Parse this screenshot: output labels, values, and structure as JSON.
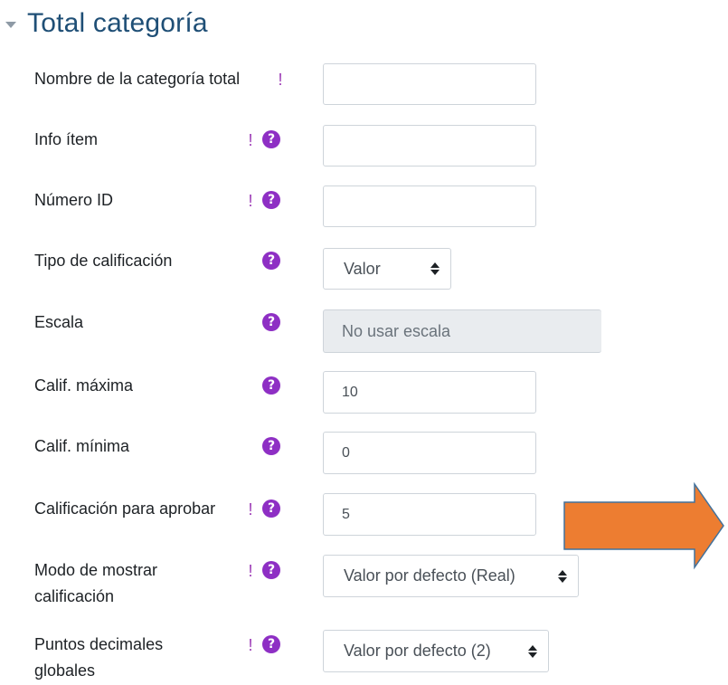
{
  "section": {
    "title": "Total categoría",
    "icon": "caret-down-icon"
  },
  "required_mark": "!",
  "help_mark": "?",
  "fields": {
    "category_name": {
      "label": "Nombre de la categoría total",
      "value": ""
    },
    "item_info": {
      "label": "Info ítem",
      "value": ""
    },
    "id_number": {
      "label": "Número ID",
      "value": ""
    },
    "grade_type": {
      "label": "Tipo de calificación",
      "value": "Valor"
    },
    "scale": {
      "label": "Escala",
      "value": "No usar escala"
    },
    "max_grade": {
      "label": "Calif. máxima",
      "value": "10"
    },
    "min_grade": {
      "label": "Calif. mínima",
      "value": "0"
    },
    "pass_grade": {
      "label": "Calificación para aprobar",
      "value": "5"
    },
    "display_type": {
      "label": "Modo de mostrar calificación",
      "value": "Valor por defecto (Real)"
    },
    "decimal_points": {
      "label": "Puntos decimales globales",
      "value": "Valor por defecto (2)"
    }
  },
  "colors": {
    "title": "#1f4f76",
    "help_icon": "#8e2fc4",
    "required": "#9b38b5",
    "arrow_fill": "#ed7d31",
    "arrow_stroke": "#41719c"
  }
}
